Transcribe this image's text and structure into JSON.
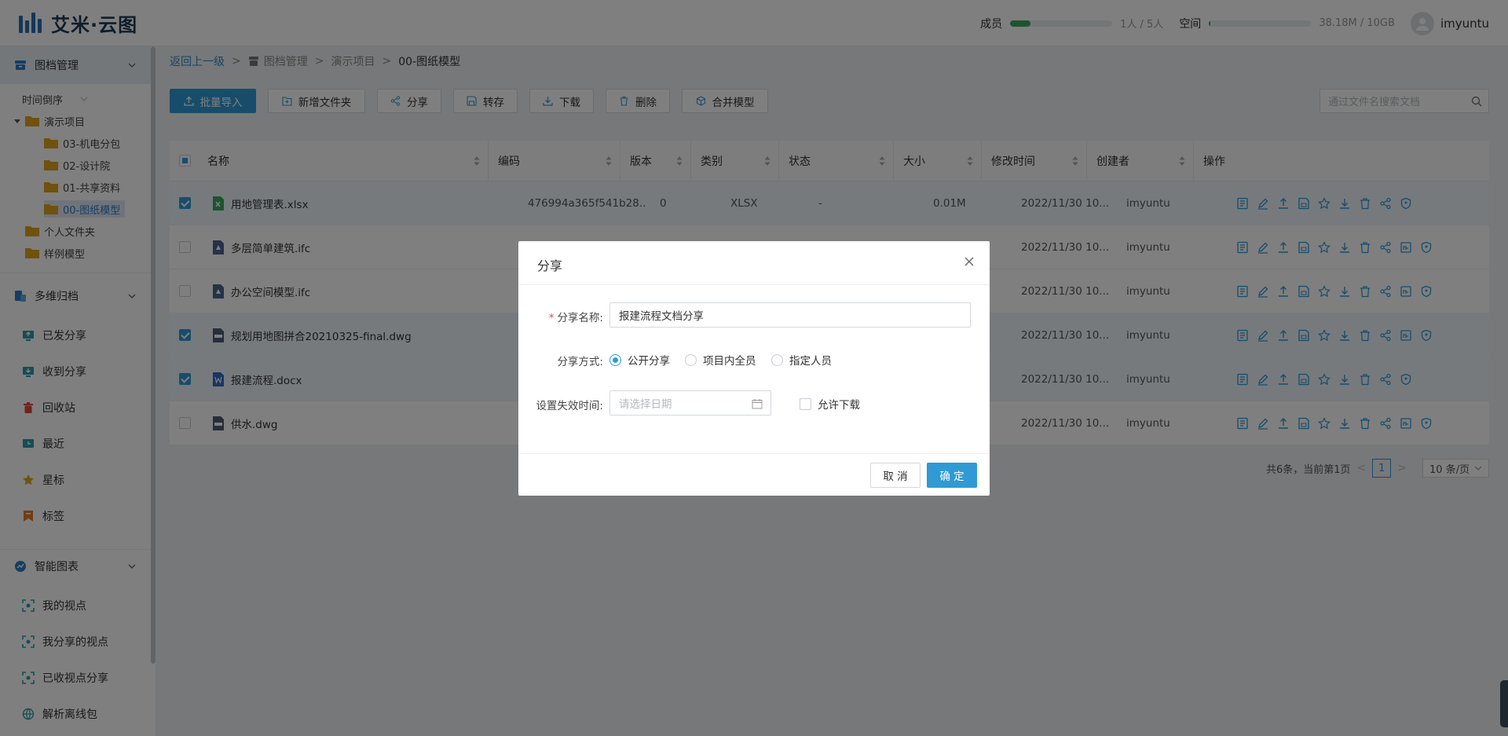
{
  "app": {
    "logo_text": "艾米·云图",
    "members_label": "成员",
    "members_value": "1人 / 5人",
    "members_fraction": 0.2,
    "space_label": "空间",
    "space_value": "38.18M / 10GB",
    "space_fraction": 0.004,
    "username": "imyuntu"
  },
  "sidebar": {
    "section1": "图档管理",
    "sort_label": "时间倒序",
    "tree": {
      "root": "演示项目",
      "children": [
        "03-机电分包",
        "02-设计院",
        "01-共享资料",
        "00-图纸模型"
      ],
      "personal": "个人文件夹",
      "samples": "样例模型"
    },
    "section2": "多维归档",
    "nav2": [
      "已发分享",
      "收到分享",
      "回收站",
      "最近",
      "星标",
      "标签"
    ],
    "section3": "智能图表",
    "nav3": [
      "我的视点",
      "我分享的视点",
      "已收视点分享",
      "解析离线包"
    ]
  },
  "breadcrumb": {
    "back": "返回上一级",
    "items": [
      "图档管理",
      "演示项目"
    ],
    "current": "00-图纸模型"
  },
  "toolbar": {
    "import": "批量导入",
    "new_folder": "新增文件夹",
    "share": "分享",
    "transfer": "转存",
    "download": "下载",
    "delete": "删除",
    "merge": "合并模型",
    "search_placeholder": "通过文件名搜索文档"
  },
  "table": {
    "columns": [
      "名称",
      "编码",
      "版本",
      "类别",
      "状态",
      "大小",
      "修改时间",
      "创建者",
      "操作"
    ],
    "rows": [
      {
        "name": "用地管理表.xlsx",
        "code": "476994a365f541b28...",
        "version": "0",
        "type": "XLSX",
        "status": "-",
        "size": "0.01M",
        "modified": "2022/11/30 10...",
        "creator": "imyuntu",
        "checked": true,
        "icon": "excel-icon"
      },
      {
        "name": "多层简单建筑.ifc",
        "code": "",
        "version": "",
        "type": "",
        "status": "",
        "size": "",
        "modified": "2022/11/30 10...",
        "creator": "imyuntu",
        "checked": false,
        "icon": "ifc-icon"
      },
      {
        "name": "办公空间模型.ifc",
        "code": "",
        "version": "",
        "type": "",
        "status": "",
        "size": "",
        "modified": "2022/11/30 10...",
        "creator": "imyuntu",
        "checked": false,
        "icon": "ifc-icon"
      },
      {
        "name": "规划用地图拼合20210325-final.dwg",
        "code": "",
        "version": "",
        "type": "",
        "status": "",
        "size": "",
        "modified": "2022/11/30 10...",
        "creator": "imyuntu",
        "checked": true,
        "icon": "cad-icon"
      },
      {
        "name": "报建流程.docx",
        "code": "",
        "version": "",
        "type": "",
        "status": "",
        "size": "",
        "modified": "2022/11/30 10...",
        "creator": "imyuntu",
        "checked": true,
        "icon": "word-icon"
      },
      {
        "name": "供水.dwg",
        "code": "",
        "version": "",
        "type": "",
        "status": "",
        "size": "",
        "modified": "2022/11/30 10...",
        "creator": "imyuntu",
        "checked": false,
        "icon": "cad-icon"
      }
    ]
  },
  "pager": {
    "summary": "共6条，当前第1页",
    "prev": "<",
    "page": "1",
    "next": ">",
    "size": "10 条/页"
  },
  "dialog": {
    "title": "分享",
    "name_label": "分享名称:",
    "name_value": "报建流程文档分享",
    "mode_label": "分享方式:",
    "modes": [
      "公开分享",
      "项目内全员",
      "指定人员"
    ],
    "selected_mode": "公开分享",
    "expire_label": "设置失效时间:",
    "date_placeholder": "请选择日期",
    "allow_download": "允许下载",
    "cancel": "取 消",
    "confirm": "确 定"
  },
  "colors": {
    "accent": "#2f9ad4",
    "members_bar": "#3aa85c",
    "required": "#e0473d"
  }
}
